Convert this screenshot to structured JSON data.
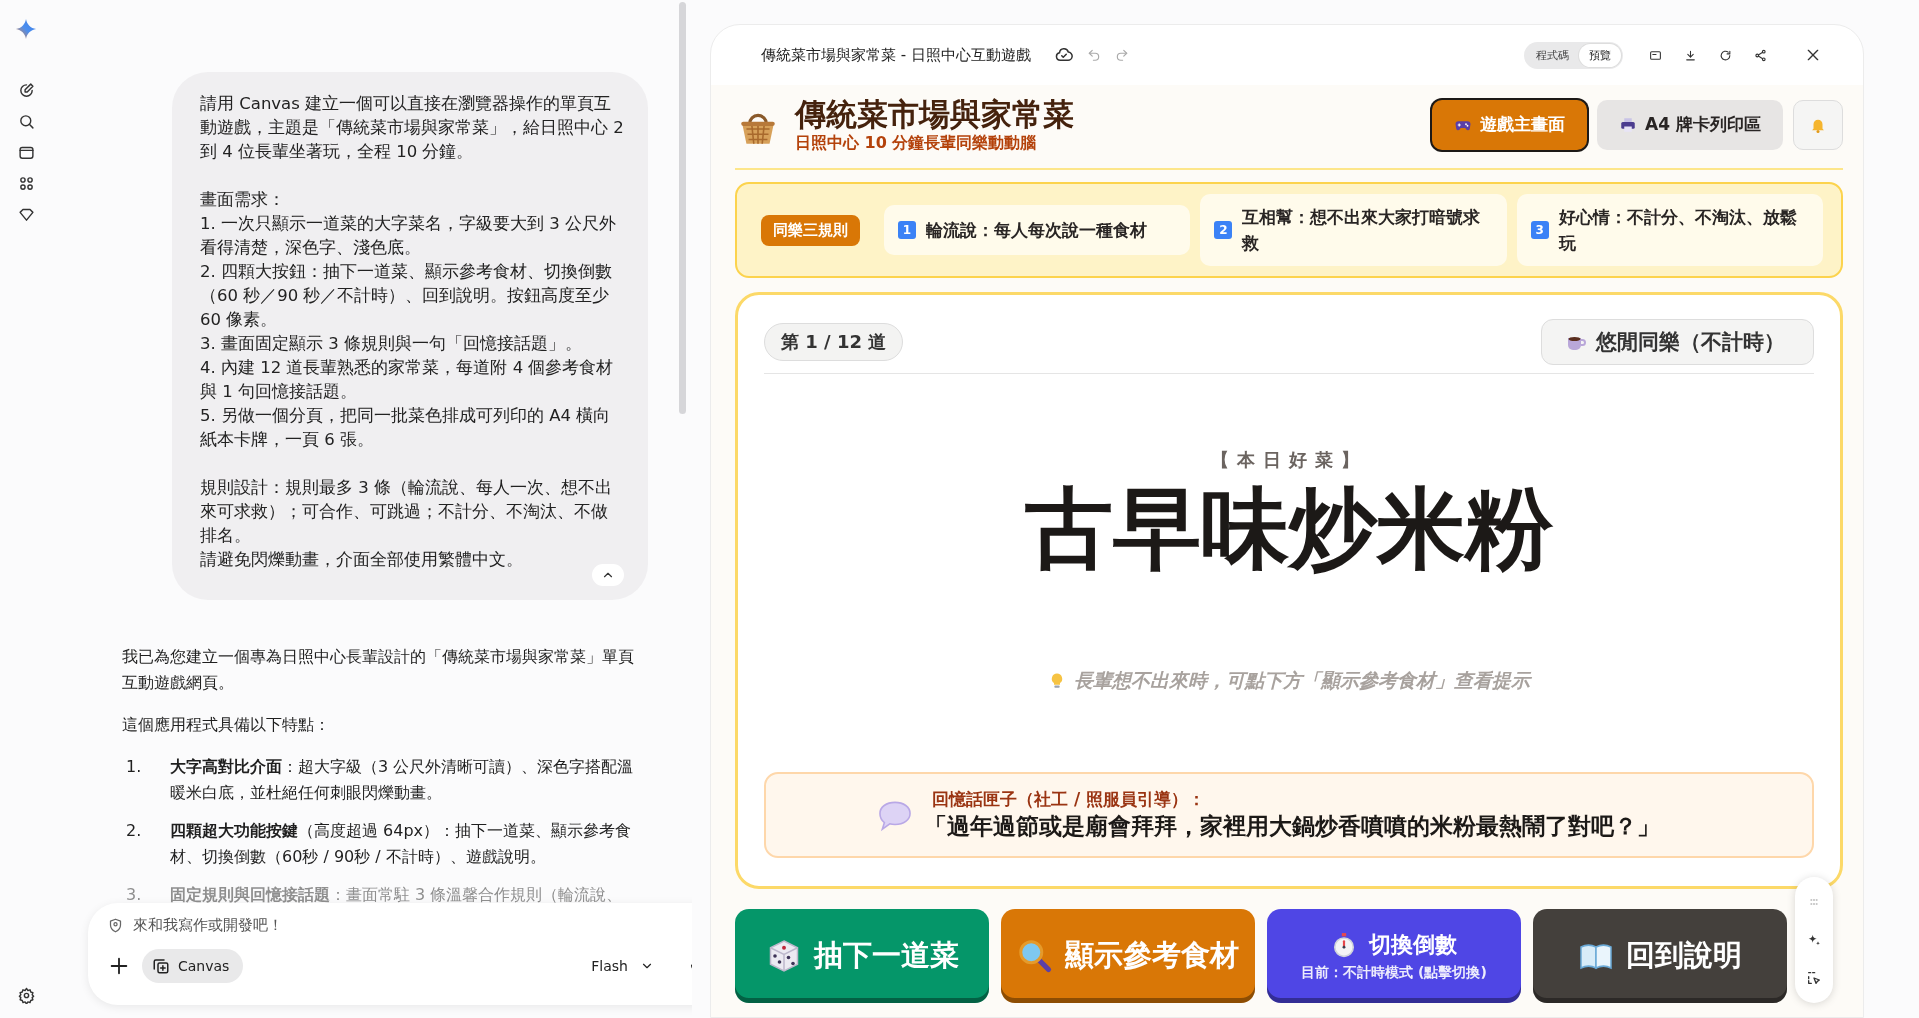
{
  "chat": {
    "user_message": {
      "blocks": [
        [
          "請用 Canvas 建立一個可以直接在瀏覽器操作的單頁互動遊戲，主題是「傳統菜市場與家常菜」，給日照中心 2 到 4 位長輩坐著玩，全程 10 分鐘。"
        ],
        [
          "畫面需求：",
          "1. 一次只顯示一道菜的大字菜名，字級要大到 3 公尺外看得清楚，深色字、淺色底。",
          "2. 四顆大按鈕：抽下一道菜、顯示參考食材、切換倒數（60 秒／90 秒／不計時）、回到說明。按鈕高度至少 60 像素。",
          "3. 畫面固定顯示 3 條規則與一句「回憶接話題」。",
          "4. 內建 12 道長輩熟悉的家常菜，每道附 4 個參考食材與 1 句回憶接話題。",
          "5. 另做一個分頁，把同一批菜色排成可列印的 A4 橫向紙本卡牌，一頁 6 張。"
        ],
        [
          "規則設計：規則最多 3 條（輪流說、每人一次、想不出來可求救）；可合作、可跳過；不計分、不淘汰、不做排名。",
          "請避免閃爍動畫，介面全部使用繁體中文。"
        ]
      ]
    },
    "assistant": {
      "paragraphs": [
        "我已為您建立一個專為日照中心長輩設計的「傳統菜市場與家常菜」單頁互動遊戲網頁。",
        "這個應用程式具備以下特點："
      ],
      "items": [
        {
          "number": "1.",
          "text": "**大字高對比介面**：超大字級（3 公尺外清晰可讀）、深色字搭配溫暖米白底，並杜絕任何刺眼閃爍動畫。"
        },
        {
          "number": "2.",
          "text": "**四顆超大功能按鍵**（高度超過 64px）：抽下一道菜、顯示參考食材、切換倒數（60秒 / 90秒 / 不計時）、遊戲說明。"
        },
        {
          "number": "3.",
          "text": "**固定規則與回憶接話題**：畫面常駐 3 條溫馨合作規則（輪流說、"
        }
      ]
    },
    "composer": {
      "placeholder": "來和我寫作或開發吧！",
      "tool": "Canvas",
      "model": "Flash"
    }
  },
  "canvas": {
    "title": "傳統菜市場與家常菜 - 日照中心互動遊戲",
    "view_toggle": [
      {
        "label": "程式碼",
        "selected": false
      },
      {
        "label": "預覽",
        "selected": true
      }
    ]
  },
  "app": {
    "title": "傳統菜市場與家常菜",
    "subtitle": "日照中心 10 分鐘長輩同樂動動腦",
    "nav": [
      {
        "kind": "game",
        "label": "遊戲主畫面",
        "selected": true
      },
      {
        "kind": "print",
        "label": "A4 牌卡列印區",
        "selected": false
      }
    ],
    "rules": {
      "label": "同樂三規則",
      "items": [
        {
          "number": "1",
          "text": "輪流說：每人每次說一種食材"
        },
        {
          "number": "2",
          "text": "互相幫：想不出來大家打暗號求救"
        },
        {
          "number": "3",
          "text": "好心情：不計分、不淘汰、放鬆玩"
        }
      ]
    },
    "card": {
      "counter": "第 1 / 12 道",
      "timer": "悠閒同樂（不計時）",
      "eyebrow": "【本日好菜】",
      "dish": "古早味炒米粉",
      "hint": "長輩想不出來時，可點下方「顯示參考食材」查看提示",
      "memory_label": "回憶話匣子（社工 / 照服員引導）：",
      "memory_quote": "「過年過節或是廟會拜拜，家裡用大鍋炒香噴噴的米粉最熱鬧了對吧？」"
    },
    "actions": [
      {
        "kind": "dice",
        "label": "抽下一道菜",
        "color": "#059669"
      },
      {
        "kind": "search",
        "label": "顯示參考食材",
        "color": "#d97706"
      },
      {
        "kind": "timer",
        "label": "切換倒數",
        "sub": "目前：不計時模式 (點擊切換)",
        "color": "#4f46e5"
      },
      {
        "kind": "book",
        "label": "回到說明",
        "color": "#44403c"
      }
    ]
  }
}
